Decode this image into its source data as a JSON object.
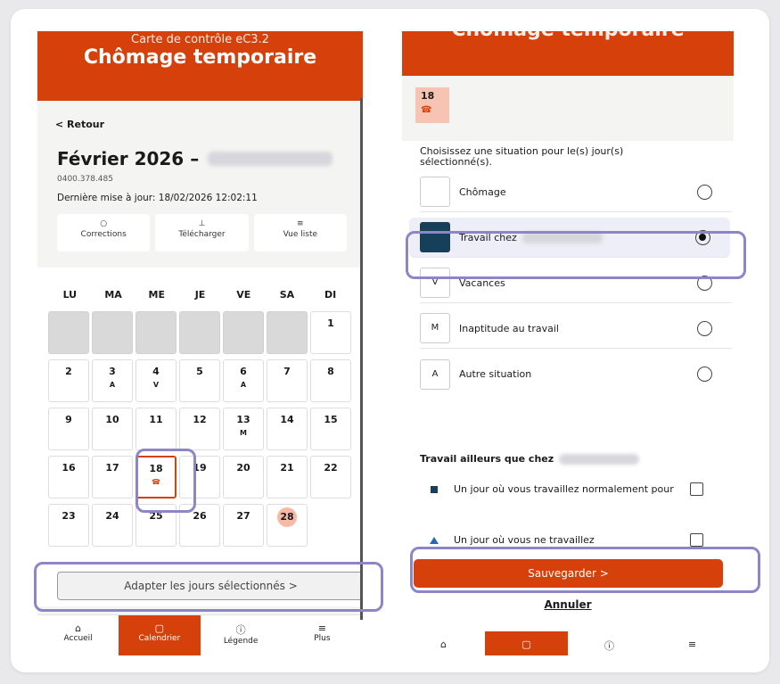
{
  "left": {
    "header_sub": "Carte de contrôle eC3.2",
    "header_title": "Chômage temporaire",
    "back": "< Retour",
    "month": "Février 2026 –",
    "number": "0400.378.485",
    "updated": "Dernière mise à jour: 18/02/2026 12:02:11",
    "actions": [
      {
        "icon": "comment-icon",
        "glyph": "○",
        "label": "Corrections"
      },
      {
        "icon": "download-icon",
        "glyph": "⊥",
        "label": "Télécharger"
      },
      {
        "icon": "list-icon",
        "glyph": "≡",
        "label": "Vue liste"
      }
    ],
    "weekdays": [
      "LU",
      "MA",
      "ME",
      "JE",
      "VE",
      "SA",
      "DI"
    ],
    "days": {
      "1": "1",
      "2": "2",
      "3": "3",
      "3c": "A",
      "4": "4",
      "4c": "V",
      "5": "5",
      "6": "6",
      "6c": "A",
      "7": "7",
      "8": "8",
      "9": "9",
      "10": "10",
      "11": "11",
      "12": "12",
      "13": "13",
      "13c": "M",
      "14": "14",
      "15": "15",
      "16": "16",
      "17": "17",
      "18": "18",
      "18c": "☎",
      "19": "19",
      "20": "20",
      "21": "21",
      "22": "22",
      "23": "23",
      "24": "24",
      "25": "25",
      "26": "26",
      "27": "27",
      "28": "28"
    },
    "adapt": "Adapter les jours sélectionnés >",
    "nav": [
      {
        "icon": "home-icon",
        "glyph": "⌂",
        "label": "Accueil"
      },
      {
        "icon": "calendar-icon",
        "glyph": "▢",
        "label": "Calendrier"
      },
      {
        "icon": "info-icon",
        "glyph": "ⓘ",
        "label": "Légende"
      },
      {
        "icon": "menu-icon",
        "glyph": "≡",
        "label": "Plus"
      }
    ]
  },
  "right": {
    "header_title": "Chômage temporaire",
    "day": "18",
    "day_code": "☎",
    "instruction": "Choisissez une situation pour le(s) jour(s) sélectionné(s).",
    "options": [
      {
        "code": "",
        "label": "Chômage"
      },
      {
        "code": "",
        "label": "Travail chez"
      },
      {
        "code": "V",
        "label": "Vacances"
      },
      {
        "code": "M",
        "label": "Inaptitude au travail"
      },
      {
        "code": "A",
        "label": "Autre situation"
      }
    ],
    "section": "Travail ailleurs que chez",
    "extra1": "Un jour où vous travaillez normalement pour",
    "extra2": "Un jour où vous ne travaillez",
    "save": "Sauvegarder >",
    "cancel": "Annuler",
    "nav_glyphs": [
      "⌂",
      "▢",
      "ⓘ",
      "≡"
    ]
  },
  "colors": {
    "brand": "#d6400a",
    "dark": "#16405a",
    "highlight": "#8c86c8",
    "today": "#f7b9a5"
  }
}
